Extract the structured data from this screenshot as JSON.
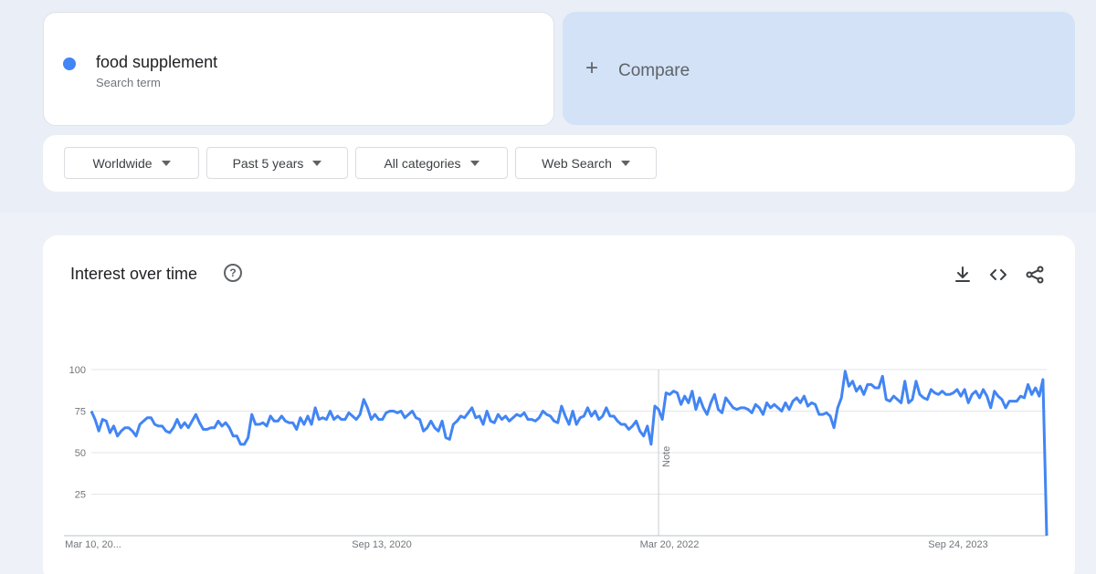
{
  "search_term": {
    "name": "food supplement",
    "subtitle": "Search term",
    "color": "#4285f4"
  },
  "compare": {
    "plus": "+",
    "label": "Compare"
  },
  "filters": [
    {
      "label": "Worldwide"
    },
    {
      "label": "Past 5 years"
    },
    {
      "label": "All categories"
    },
    {
      "label": "Web Search"
    }
  ],
  "chart": {
    "title": "Interest over time",
    "help_icon": "?",
    "icons": [
      "download-icon",
      "embed-code-icon",
      "share-icon"
    ],
    "note_label": "Note"
  },
  "chart_data": {
    "type": "line",
    "title": "Interest over time",
    "series_color": "#4285f4",
    "x_ticks": [
      "Mar 10, 20...",
      "Sep 13, 2020",
      "Mar 20, 2022",
      "Sep 24, 2023"
    ],
    "y_ticks": [
      "100",
      "75",
      "50",
      "25"
    ],
    "ylim": [
      0,
      100
    ],
    "grid": true,
    "note_marker_index": 152,
    "series": [
      {
        "values": [
          75,
          70,
          63,
          70,
          69,
          62,
          66,
          60,
          63,
          65,
          65,
          63,
          60,
          67,
          69,
          71,
          71,
          67,
          66,
          66,
          63,
          62,
          65,
          70,
          65,
          68,
          65,
          69,
          73,
          68,
          64,
          64,
          65,
          65,
          69,
          66,
          68,
          65,
          60,
          60,
          55,
          55,
          59,
          73,
          67,
          67,
          68,
          66,
          72,
          69,
          69,
          72,
          69,
          68,
          68,
          64,
          71,
          67,
          72,
          67,
          77,
          70,
          71,
          70,
          75,
          70,
          72,
          70,
          70,
          74,
          72,
          70,
          73,
          82,
          77,
          70,
          73,
          70,
          70,
          74,
          75,
          75,
          74,
          75,
          71,
          73,
          75,
          71,
          70,
          63,
          65,
          69,
          65,
          63,
          69,
          59,
          58,
          67,
          69,
          72,
          71,
          74,
          77,
          71,
          72,
          67,
          75,
          69,
          68,
          73,
          70,
          72,
          69,
          71,
          73,
          72,
          74,
          70,
          70,
          69,
          71,
          75,
          73,
          72,
          69,
          68,
          78,
          72,
          67,
          75,
          67,
          71,
          72,
          77,
          72,
          75,
          70,
          72,
          77,
          72,
          72,
          69,
          67,
          67,
          64,
          66,
          69,
          63,
          60,
          66,
          55,
          78,
          76,
          70,
          86,
          85,
          87,
          86,
          79,
          84,
          80,
          87,
          76,
          83,
          77,
          73,
          80,
          85,
          76,
          74,
          83,
          80,
          77,
          76,
          77,
          77,
          76,
          74,
          79,
          77,
          73,
          80,
          77,
          79,
          77,
          75,
          80,
          76,
          81,
          83,
          80,
          84,
          78,
          80,
          79,
          73,
          73,
          74,
          72,
          65,
          77,
          83,
          99,
          90,
          93,
          87,
          90,
          85,
          91,
          91,
          89,
          89,
          96,
          82,
          81,
          84,
          82,
          80,
          93,
          80,
          82,
          93,
          85,
          83,
          82,
          88,
          86,
          85,
          87,
          85,
          85,
          86,
          88,
          84,
          88,
          80,
          85,
          87,
          83,
          88,
          84,
          77,
          87,
          84,
          82,
          77,
          81,
          81,
          81,
          84,
          83,
          91,
          85,
          89,
          84,
          94,
          0
        ]
      }
    ]
  }
}
